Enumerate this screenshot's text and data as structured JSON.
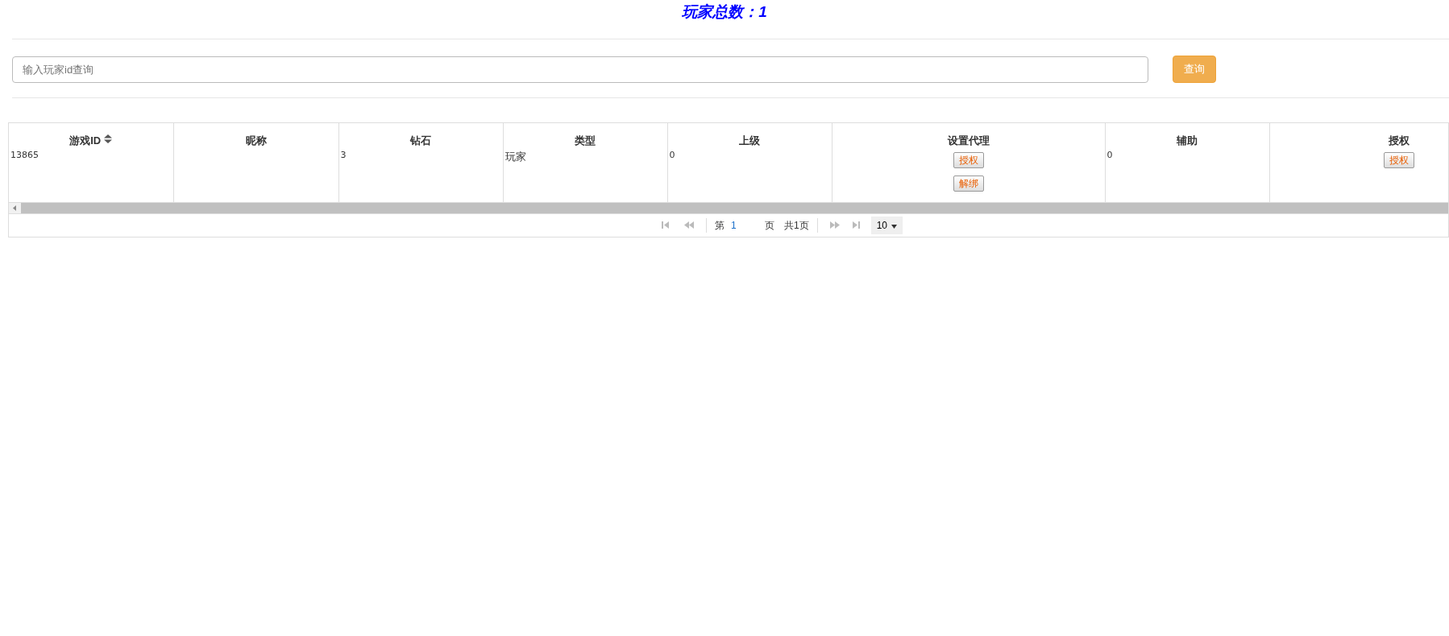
{
  "title": "玩家总数：1",
  "search": {
    "placeholder": "输入玩家id查询",
    "button": "查询"
  },
  "table": {
    "columns": [
      {
        "label": "游戏ID",
        "sortable": true
      },
      {
        "label": "昵称",
        "sortable": false
      },
      {
        "label": "钻石",
        "sortable": false
      },
      {
        "label": "类型",
        "sortable": false
      },
      {
        "label": "上级",
        "sortable": false
      },
      {
        "label": "设置代理",
        "sortable": false
      },
      {
        "label": "辅助",
        "sortable": false
      },
      {
        "label": "授权",
        "sortable": false
      }
    ],
    "rows": [
      {
        "cells": [
          {
            "kind": "text",
            "text": "13865"
          },
          {
            "kind": "blank"
          },
          {
            "kind": "text",
            "text": "3"
          },
          {
            "kind": "wide",
            "text": "玩家"
          },
          {
            "kind": "text",
            "text": "0"
          },
          {
            "kind": "buttons",
            "buttons": [
              "授权",
              "解绑"
            ]
          },
          {
            "kind": "text",
            "text": "0"
          },
          {
            "kind": "buttons",
            "buttons": [
              "授权"
            ]
          }
        ]
      }
    ]
  },
  "pager": {
    "nav_before": [
      {
        "kind": "first",
        "disabled": true
      },
      {
        "kind": "prev",
        "disabled": true
      }
    ],
    "page_prefix": "第",
    "page_value": "1",
    "page_suffix": "页",
    "total": "共1页",
    "nav_after": [
      {
        "kind": "next",
        "disabled": true
      },
      {
        "kind": "last",
        "disabled": true
      }
    ],
    "page_size": "10"
  }
}
